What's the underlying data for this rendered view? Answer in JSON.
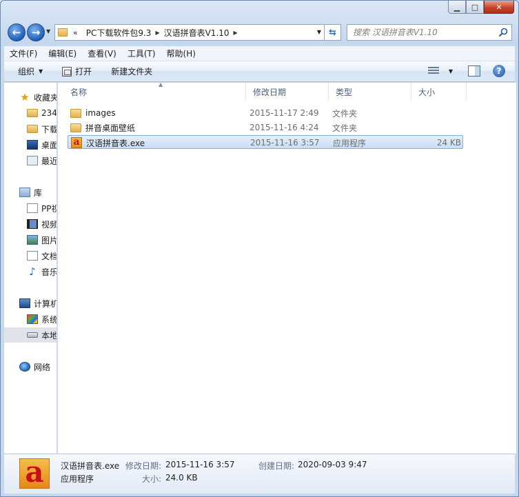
{
  "window": {
    "minimize_label": "▁",
    "maximize_label": "□",
    "close_label": "✕"
  },
  "nav": {
    "address": {
      "overflow": "«",
      "segments": [
        "PC下载软件包9.3",
        "汉语拼音表V1.10"
      ]
    },
    "search": {
      "placeholder": "搜索 汉语拼音表V1.10"
    }
  },
  "menubar": [
    "文件(F)",
    "编辑(E)",
    "查看(V)",
    "工具(T)",
    "帮助(H)"
  ],
  "toolbar": {
    "organize": "组织",
    "open": "打开",
    "new_folder": "新建文件夹",
    "help": "?"
  },
  "sidebar": {
    "items": [
      {
        "label": "收藏夹",
        "icon": "star-icon"
      },
      {
        "label": "234",
        "icon": "folder-icon"
      },
      {
        "label": "下载",
        "icon": "downloads-icon"
      },
      {
        "label": "桌面",
        "icon": "desktop-icon"
      },
      {
        "label": "最近",
        "icon": "recent-places-icon"
      },
      {
        "label": "库",
        "icon": "library-icon"
      },
      {
        "label": "PP视",
        "icon": "pp-video-icon"
      },
      {
        "label": "视频",
        "icon": "videos-icon"
      },
      {
        "label": "图片",
        "icon": "pictures-icon"
      },
      {
        "label": "文档",
        "icon": "documents-icon"
      },
      {
        "label": "音乐",
        "icon": "music-icon"
      },
      {
        "label": "计算机",
        "icon": "computer-icon"
      },
      {
        "label": "系统",
        "icon": "system-drive-icon"
      },
      {
        "label": "本地",
        "icon": "local-disk-icon"
      },
      {
        "label": "网络",
        "icon": "network-icon"
      }
    ]
  },
  "columns": {
    "name": "名称",
    "modified": "修改日期",
    "type": "类型",
    "size": "大小"
  },
  "files": [
    {
      "name": "images",
      "modified": "2015-11-17 2:49",
      "type": "文件夹",
      "size": ""
    },
    {
      "name": "拼音桌面壁纸",
      "modified": "2015-11-16 4:24",
      "type": "文件夹",
      "size": ""
    },
    {
      "name": "汉语拼音表.exe",
      "modified": "2015-11-16 3:57",
      "type": "应用程序",
      "size": "24 KB"
    }
  ],
  "details": {
    "filename": "汉语拼音表.exe",
    "filetype": "应用程序",
    "modified_label": "修改日期:",
    "modified_value": "2015-11-16 3:57",
    "size_label": "大小:",
    "size_value": "24.0 KB",
    "created_label": "创建日期:",
    "created_value": "2020-09-03 9:47",
    "icon_letter": "a"
  },
  "colors": {
    "selection_bg": "#cce2f7",
    "selection_border": "#84acdd",
    "app_icon": "#e58d1a"
  }
}
